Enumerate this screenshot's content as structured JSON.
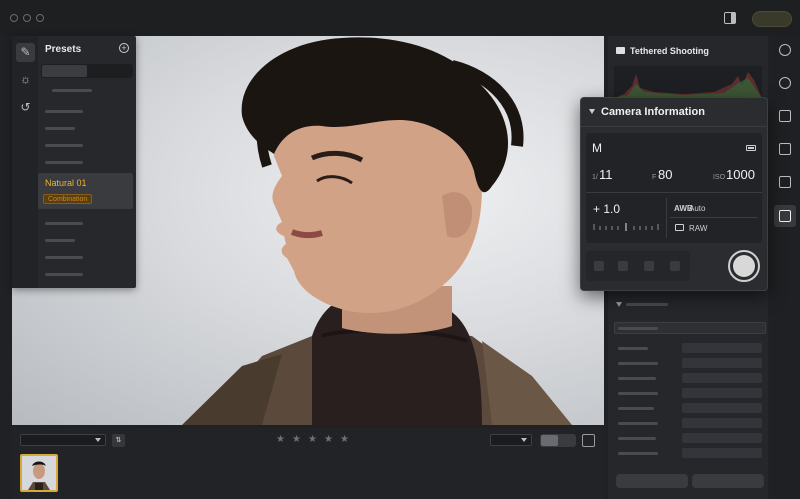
{
  "presets": {
    "title": "Presets",
    "selected_name": "Natural 01",
    "selected_tag": "Combination"
  },
  "tethered": {
    "title": "Tethered Shooting"
  },
  "camera_info": {
    "title": "Camera Information",
    "mode": "M",
    "shutter_label": "1/",
    "shutter_value": "11",
    "aperture_label": "F",
    "aperture_value": "80",
    "iso_label": "ISO",
    "iso_value": "1000",
    "exposure_comp": "+ 1.0",
    "wb_icon": "AWB",
    "wb_value": "Auto",
    "format_value": "RAW"
  },
  "icons": {
    "rail_left": [
      "presets-icon",
      "adjustments-icon",
      "history-icon"
    ],
    "rail_right": [
      "palette-icon",
      "face-icon",
      "image-icon",
      "shirt-icon",
      "crop-icon",
      "camera-icon"
    ]
  },
  "filmstrip": {
    "stars": [
      "★",
      "★",
      "★",
      "★",
      "★"
    ],
    "sort_glyph": "⇅"
  },
  "colors": {
    "accent": "#f0b429",
    "tag_text": "#c58a1b",
    "thumb_border": "#d7a93a"
  }
}
